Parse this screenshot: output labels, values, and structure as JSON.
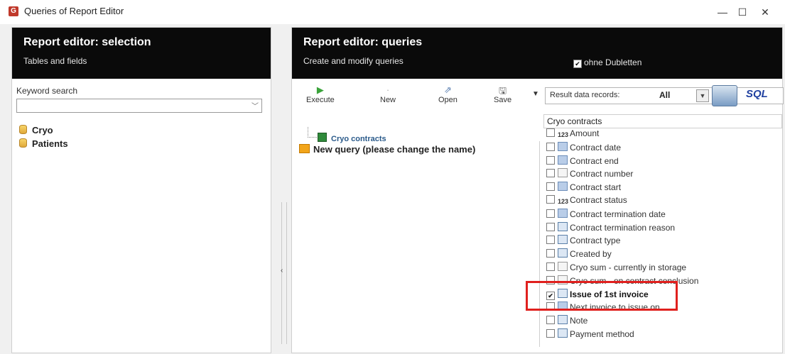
{
  "window": {
    "title": "Queries of Report Editor",
    "minimize": "—",
    "maximize": "☐",
    "close": "✕"
  },
  "left_panel": {
    "title": "Report editor: selection",
    "subtitle": "Tables and fields",
    "keyword_label": "Keyword search",
    "keyword_value": "",
    "tree": [
      "Cryo",
      "Patients"
    ]
  },
  "right_panel": {
    "title": "Report editor: queries",
    "subtitle": "Create and modify queries",
    "ohne_dubletten_label": "ohne Dubletten",
    "ohne_dubletten_checked": true,
    "toolbar": {
      "execute": "Execute",
      "new": "New",
      "open": "Open",
      "save": "Save"
    },
    "result_label": "Result data records:",
    "result_value": "All",
    "sql_label": "SQL",
    "query_name": "New query (please change the name)",
    "query_table": "Cryo contracts",
    "fields_header": "Cryo contracts",
    "fields": [
      {
        "label": "Amount",
        "icon": "number-icon",
        "checked": false
      },
      {
        "label": "Contract date",
        "icon": "calendar-icon",
        "checked": false
      },
      {
        "label": "Contract end",
        "icon": "calendar-icon",
        "checked": false
      },
      {
        "label": "Contract number",
        "icon": "text-icon",
        "checked": false
      },
      {
        "label": "Contract start",
        "icon": "calendar-icon",
        "checked": false
      },
      {
        "label": "Contract status",
        "icon": "number-icon",
        "checked": false
      },
      {
        "label": "Contract termination date",
        "icon": "calendar-icon",
        "checked": false
      },
      {
        "label": "Contract termination reason",
        "icon": "list-icon",
        "checked": false
      },
      {
        "label": "Contract type",
        "icon": "list-icon",
        "checked": false
      },
      {
        "label": "Created by",
        "icon": "list-icon",
        "checked": false
      },
      {
        "label": "Cryo sum - currently in storage",
        "icon": "text-icon",
        "checked": false
      },
      {
        "label": "Cryo sum - on contract conclusion",
        "icon": "text-icon",
        "checked": false
      },
      {
        "label": "Issue of 1st invoice",
        "icon": "list-icon",
        "checked": true
      },
      {
        "label": "Next invoice to issue on",
        "icon": "calendar-icon",
        "checked": false
      },
      {
        "label": "Note",
        "icon": "note-icon",
        "checked": false
      },
      {
        "label": "Payment method",
        "icon": "list-icon",
        "checked": false
      }
    ]
  },
  "colors": {
    "header_bg": "#0a0a0a",
    "highlight_border": "#e0201e",
    "execute_green": "#3aa33a"
  }
}
